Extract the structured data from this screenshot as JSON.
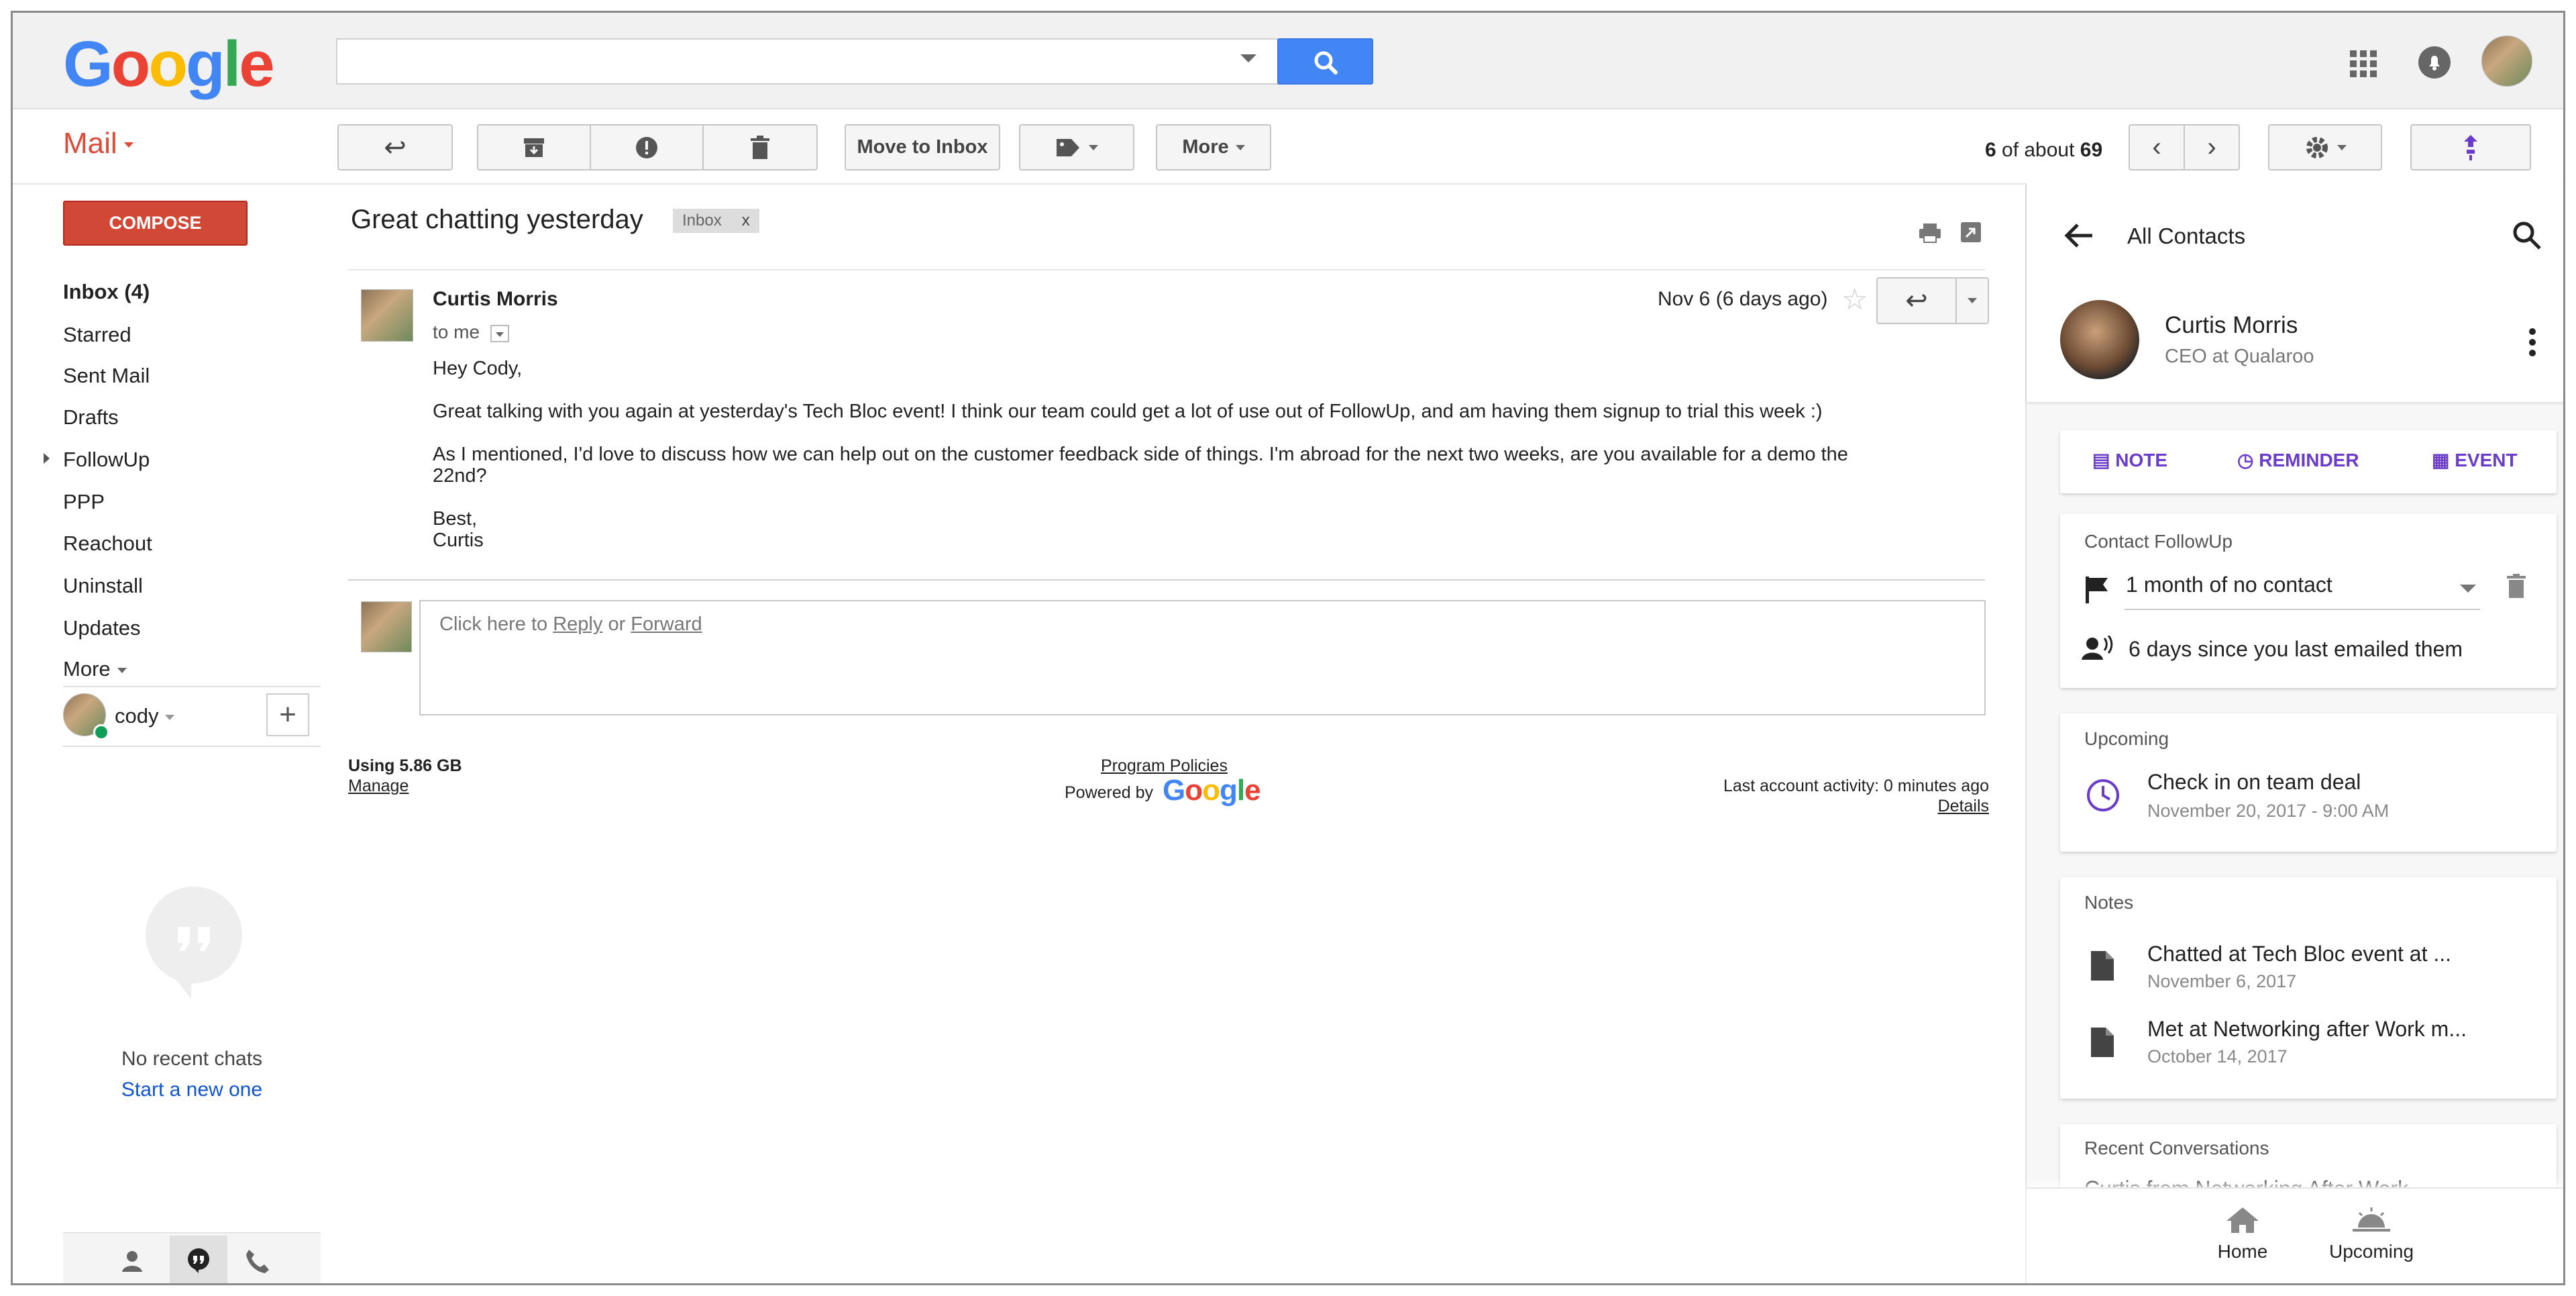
{
  "header": {
    "logo": "Google",
    "search": {
      "placeholder": ""
    }
  },
  "toolbar": {
    "move_to_inbox": "Move to Inbox",
    "more": "More",
    "pager": {
      "current": "6",
      "mid": " of about ",
      "total": "69"
    }
  },
  "nav": {
    "mail_label": "Mail",
    "compose": "COMPOSE",
    "items": [
      {
        "label": "Inbox (4)",
        "bold": true
      },
      {
        "label": "Starred"
      },
      {
        "label": "Sent Mail"
      },
      {
        "label": "Drafts"
      },
      {
        "label": "FollowUp"
      },
      {
        "label": "PPP"
      },
      {
        "label": "Reachout"
      },
      {
        "label": "Uninstall"
      },
      {
        "label": "Updates"
      }
    ],
    "more": "More",
    "account": "cody",
    "no_chats": "No recent chats",
    "start_new": "Start a new one"
  },
  "email": {
    "subject": "Great chatting yesterday",
    "label": "Inbox",
    "label_close": "x",
    "sender": "Curtis Morris",
    "to": "to me",
    "date": "Nov 6 (6 days ago)",
    "greeting": "Hey Cody,",
    "p1": "Great talking with you again at yesterday's Tech Bloc event! I think our team could get a lot of use out of FollowUp, and am having them signup to trial this week :)",
    "p2a": "As I mentioned, I'd love to discuss how we can help out on the customer feedback side of things. I'm abroad for the next two weeks, are you available for a demo the",
    "p2b": "22nd?",
    "signoff": "Best,",
    "signname": "Curtis",
    "reply_prefix": "Click here to ",
    "reply_link": "Reply",
    "reply_or": " or ",
    "forward_link": "Forward"
  },
  "footer": {
    "storage": "Using 5.86 GB",
    "manage": "Manage",
    "policies": "Program Policies",
    "powered": "Powered by",
    "powered_logo": "Google",
    "activity": "Last account activity: 0 minutes ago",
    "details": "Details"
  },
  "panel": {
    "title": "All Contacts",
    "contact_name": "Curtis Morris",
    "contact_role": "CEO at Qualaroo",
    "actions": {
      "note": "NOTE",
      "reminder": "REMINDER",
      "event": "EVENT"
    },
    "followup": {
      "title": "Contact FollowUp",
      "rule": "1 month of no contact",
      "since": "6 days since you last emailed them"
    },
    "upcoming": {
      "title": "Upcoming",
      "item_title": "Check in on team deal",
      "item_date": "November 20, 2017 - 9:00 AM"
    },
    "notes": {
      "title": "Notes",
      "items": [
        {
          "title": "Chatted at Tech Bloc event at ...",
          "date": "November 6, 2017"
        },
        {
          "title": "Met at Networking after Work m...",
          "date": "October 14, 2017"
        }
      ]
    },
    "recent": {
      "title": "Recent Conversations",
      "first": "Curtis from Networking After Work"
    },
    "bottom_nav": {
      "home": "Home",
      "upcoming": "Upcoming"
    }
  },
  "colors": {
    "accent_red": "#dd4b39",
    "compose_red": "#d14836",
    "search_blue": "#4285f4",
    "purple": "#6a3cc9"
  }
}
